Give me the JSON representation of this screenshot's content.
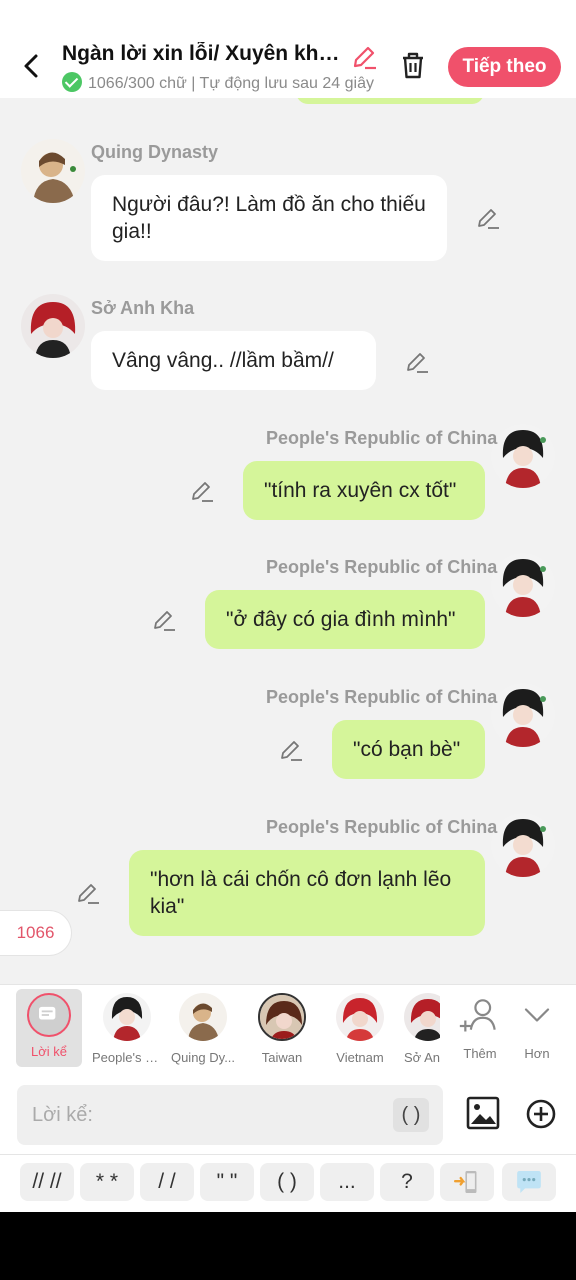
{
  "header": {
    "title": "Ngàn lời xin lỗi/ Xuyên không Qing Dynasty",
    "subtitle": "1066/300 chữ | Tự động lưu sau 24 giây",
    "next_label": "Tiếp theo"
  },
  "messages": [
    {
      "side": "left",
      "name": "Quing Dynasty",
      "text": "Người đâu?! Làm đồ ăn cho thiếu gia!!"
    },
    {
      "side": "left",
      "name": "Sở Anh Kha",
      "text": "Vâng vâng.. //lầm bầm//"
    },
    {
      "side": "right",
      "name": "People's Republic of China",
      "text": "\"tính ra xuyên cx tốt\""
    },
    {
      "side": "right",
      "name": "People's Republic of China",
      "text": "\"ở đây có gia đình mình\""
    },
    {
      "side": "right",
      "name": "People's Republic of China",
      "text": "\"có bạn bè\""
    },
    {
      "side": "right",
      "name": "People's Republic of China",
      "text": "\"hơn là cái chốn cô đơn lạnh lẽo kia\""
    }
  ],
  "counter": "1066",
  "characters": {
    "narration": "Lời kể",
    "list": [
      "People's R...",
      "Quing Dy...",
      "Taiwan",
      "Vietnam",
      "Sở Anh Kha"
    ],
    "more": "Thêm",
    "less": "Hơn"
  },
  "input": {
    "placeholder": "Lời kể:",
    "paren": "( )"
  },
  "quick_keys": [
    "// //",
    "* *",
    "/ /",
    "\" \"",
    "( )",
    "...",
    "?"
  ],
  "colors": {
    "accent": "#f0516b",
    "bubble_right": "#d5f59a",
    "bubble_left": "#ffffff",
    "background": "#f2f2f2"
  }
}
